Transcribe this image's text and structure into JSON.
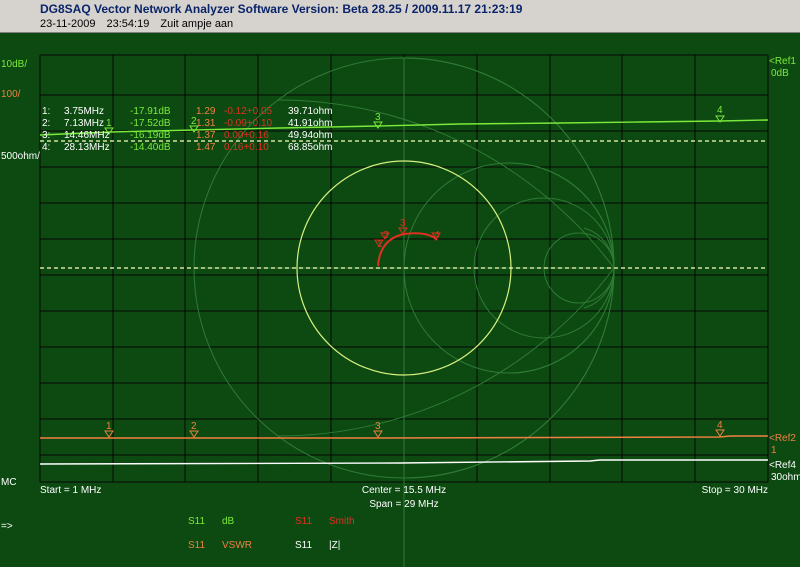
{
  "window": {
    "title": "DG8SAQ Vector Network Analyzer Software   Version:  Beta 28.25 / 2009.11.17 21:23:19",
    "date": "23-11-2009",
    "time": "23:54:19",
    "caption": "Zuit ampje aan"
  },
  "scale": {
    "db_per_div": "10dB/",
    "vswr_scale": "100/",
    "ohm_scale": "500ohm/"
  },
  "refs": {
    "ref1": "<Ref1",
    "ref1_value": "0dB",
    "ref2": "<Ref2",
    "ref2_value": "1",
    "ref4": "<Ref4",
    "ref4_value": "30ohm"
  },
  "markers": [
    {
      "num": "1:",
      "freq": "3.75MHz",
      "db": "-17.91dB",
      "vswr": "1.29",
      "smith": "-0.12+0.05",
      "z": "39.71ohm"
    },
    {
      "num": "2:",
      "freq": "7.13MHz",
      "db": "-17.52dB",
      "vswr": "1.31",
      "smith": "-0.09+0.10",
      "z": "41.91ohm"
    },
    {
      "num": "3:",
      "freq": "14.46MHz",
      "db": "-16.19dB",
      "vswr": "1.37",
      "smith": "0.00+0.16",
      "z": "49.94ohm"
    },
    {
      "num": "4:",
      "freq": "28.13MHz",
      "db": "-14.40dB",
      "vswr": "1.47",
      "smith": "0.16+0.10",
      "z": "68.85ohm"
    }
  ],
  "marker_labels": [
    "1",
    "2",
    "3",
    "4"
  ],
  "axis": {
    "mc": "MC",
    "start": "Start = 1 MHz",
    "center": "Center = 15.5 MHz",
    "span": "Span = 29 MHz",
    "stop": "Stop = 30 MHz"
  },
  "legend": {
    "arrow": "=>",
    "items": [
      {
        "param": "S11",
        "fmt": "dB"
      },
      {
        "param": "S11",
        "fmt": "Smith"
      },
      {
        "param": "S11",
        "fmt": "VSWR"
      },
      {
        "param": "S11",
        "fmt": "|Z|"
      }
    ]
  },
  "colors": {
    "background": "#0d4a12",
    "grid": "#050505",
    "smith_grid": "#2f7a34",
    "db": "#7bea3a",
    "smith": "#e03020",
    "vswr": "#f08040",
    "z": "#ffffff",
    "titlebar": "#d6d3ce"
  }
}
